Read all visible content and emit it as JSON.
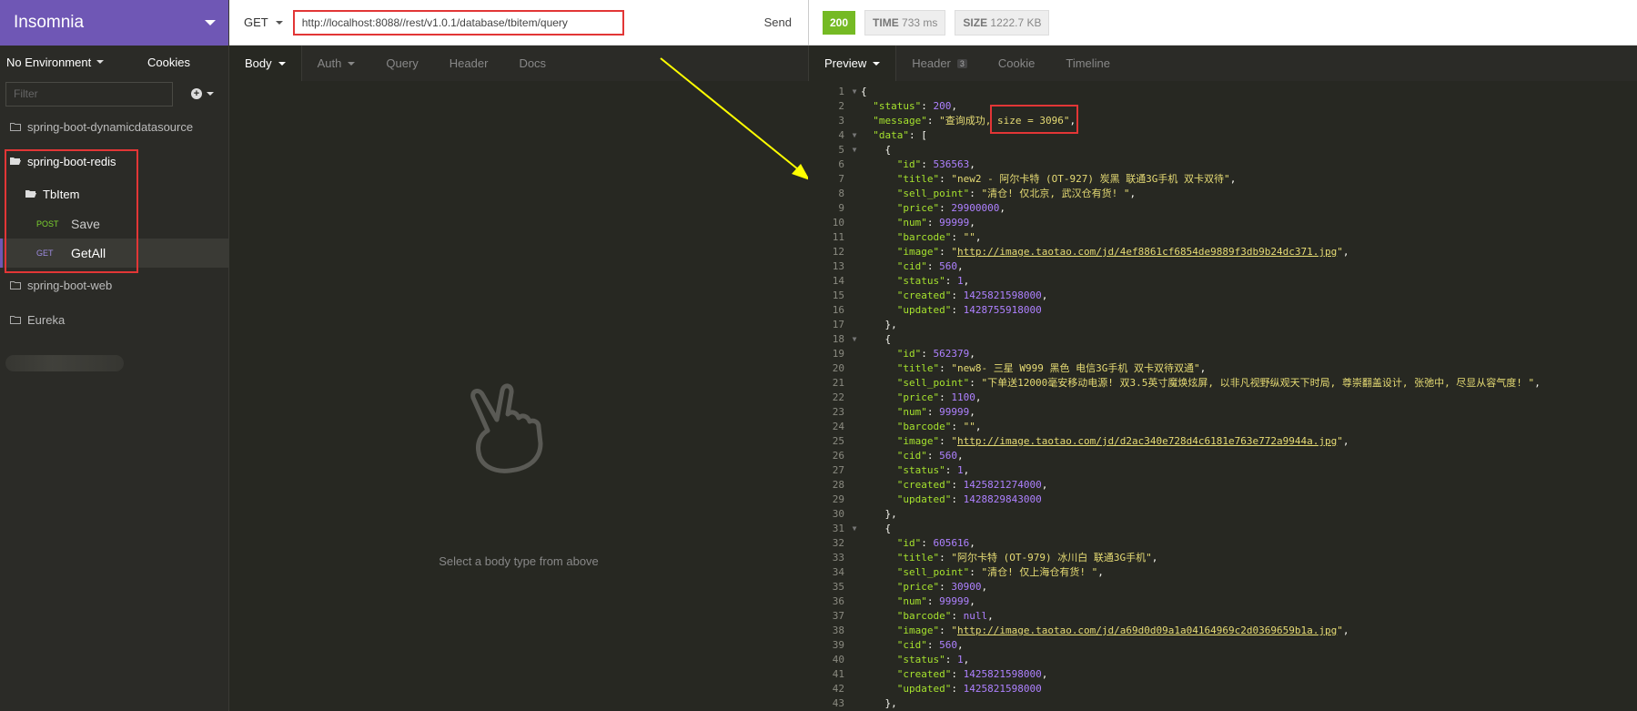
{
  "app": {
    "name": "Insomnia"
  },
  "sidebar": {
    "environment": "No Environment",
    "cookies": "Cookies",
    "filter_placeholder": "Filter",
    "folders": [
      {
        "name": "spring-boot-dynamicdatasource"
      },
      {
        "name": "spring-boot-redis"
      },
      {
        "name": "spring-boot-web"
      },
      {
        "name": "Eureka"
      }
    ],
    "subfolder": "TbItem",
    "requests": [
      {
        "method": "POST",
        "name": "Save"
      },
      {
        "method": "GET",
        "name": "GetAll"
      }
    ]
  },
  "request": {
    "method": "GET",
    "url": "http://localhost:8088//rest/v1.0.1/database/tbitem/query",
    "send": "Send",
    "tabs": [
      "Body",
      "Auth",
      "Query",
      "Header",
      "Docs"
    ],
    "empty_text": "Select a body type from above"
  },
  "response": {
    "status": "200",
    "time_label": "TIME",
    "time_value": "733 ms",
    "size_label": "SIZE",
    "size_value": "1222.7 KB",
    "tabs": [
      "Preview",
      "Header",
      "Cookie",
      "Timeline"
    ],
    "header_count": "3"
  },
  "code_lines": [
    [
      {
        "t": "p",
        "v": "{"
      }
    ],
    [
      {
        "t": "p",
        "v": "  "
      },
      {
        "t": "k",
        "v": "\"status\""
      },
      {
        "t": "p",
        "v": ": "
      },
      {
        "t": "n",
        "v": "200"
      },
      {
        "t": "p",
        "v": ","
      }
    ],
    [
      {
        "t": "p",
        "v": "  "
      },
      {
        "t": "k",
        "v": "\"message\""
      },
      {
        "t": "p",
        "v": ": "
      },
      {
        "t": "s",
        "v": "\"查询成功, size = 3096\""
      },
      {
        "t": "p",
        "v": ","
      }
    ],
    [
      {
        "t": "p",
        "v": "  "
      },
      {
        "t": "k",
        "v": "\"data\""
      },
      {
        "t": "p",
        "v": ": ["
      }
    ],
    [
      {
        "t": "p",
        "v": "    {"
      }
    ],
    [
      {
        "t": "p",
        "v": "      "
      },
      {
        "t": "k",
        "v": "\"id\""
      },
      {
        "t": "p",
        "v": ": "
      },
      {
        "t": "n",
        "v": "536563"
      },
      {
        "t": "p",
        "v": ","
      }
    ],
    [
      {
        "t": "p",
        "v": "      "
      },
      {
        "t": "k",
        "v": "\"title\""
      },
      {
        "t": "p",
        "v": ": "
      },
      {
        "t": "s",
        "v": "\"new2 - 阿尔卡特 (OT-927) 炭黑 联通3G手机 双卡双待\""
      },
      {
        "t": "p",
        "v": ","
      }
    ],
    [
      {
        "t": "p",
        "v": "      "
      },
      {
        "t": "k",
        "v": "\"sell_point\""
      },
      {
        "t": "p",
        "v": ": "
      },
      {
        "t": "s",
        "v": "\"清仓! 仅北京, 武汉仓有货! \""
      },
      {
        "t": "p",
        "v": ","
      }
    ],
    [
      {
        "t": "p",
        "v": "      "
      },
      {
        "t": "k",
        "v": "\"price\""
      },
      {
        "t": "p",
        "v": ": "
      },
      {
        "t": "n",
        "v": "29900000"
      },
      {
        "t": "p",
        "v": ","
      }
    ],
    [
      {
        "t": "p",
        "v": "      "
      },
      {
        "t": "k",
        "v": "\"num\""
      },
      {
        "t": "p",
        "v": ": "
      },
      {
        "t": "n",
        "v": "99999"
      },
      {
        "t": "p",
        "v": ","
      }
    ],
    [
      {
        "t": "p",
        "v": "      "
      },
      {
        "t": "k",
        "v": "\"barcode\""
      },
      {
        "t": "p",
        "v": ": "
      },
      {
        "t": "s",
        "v": "\"\""
      },
      {
        "t": "p",
        "v": ","
      }
    ],
    [
      {
        "t": "p",
        "v": "      "
      },
      {
        "t": "k",
        "v": "\"image\""
      },
      {
        "t": "p",
        "v": ": "
      },
      {
        "t": "s",
        "v": "\""
      },
      {
        "t": "u",
        "v": "http://image.taotao.com/jd/4ef8861cf6854de9889f3db9b24dc371.jpg"
      },
      {
        "t": "s",
        "v": "\""
      },
      {
        "t": "p",
        "v": ","
      }
    ],
    [
      {
        "t": "p",
        "v": "      "
      },
      {
        "t": "k",
        "v": "\"cid\""
      },
      {
        "t": "p",
        "v": ": "
      },
      {
        "t": "n",
        "v": "560"
      },
      {
        "t": "p",
        "v": ","
      }
    ],
    [
      {
        "t": "p",
        "v": "      "
      },
      {
        "t": "k",
        "v": "\"status\""
      },
      {
        "t": "p",
        "v": ": "
      },
      {
        "t": "n",
        "v": "1"
      },
      {
        "t": "p",
        "v": ","
      }
    ],
    [
      {
        "t": "p",
        "v": "      "
      },
      {
        "t": "k",
        "v": "\"created\""
      },
      {
        "t": "p",
        "v": ": "
      },
      {
        "t": "n",
        "v": "1425821598000"
      },
      {
        "t": "p",
        "v": ","
      }
    ],
    [
      {
        "t": "p",
        "v": "      "
      },
      {
        "t": "k",
        "v": "\"updated\""
      },
      {
        "t": "p",
        "v": ": "
      },
      {
        "t": "n",
        "v": "1428755918000"
      }
    ],
    [
      {
        "t": "p",
        "v": "    },"
      }
    ],
    [
      {
        "t": "p",
        "v": "    {"
      }
    ],
    [
      {
        "t": "p",
        "v": "      "
      },
      {
        "t": "k",
        "v": "\"id\""
      },
      {
        "t": "p",
        "v": ": "
      },
      {
        "t": "n",
        "v": "562379"
      },
      {
        "t": "p",
        "v": ","
      }
    ],
    [
      {
        "t": "p",
        "v": "      "
      },
      {
        "t": "k",
        "v": "\"title\""
      },
      {
        "t": "p",
        "v": ": "
      },
      {
        "t": "s",
        "v": "\"new8- 三星 W999 黑色 电信3G手机 双卡双待双通\""
      },
      {
        "t": "p",
        "v": ","
      }
    ],
    [
      {
        "t": "p",
        "v": "      "
      },
      {
        "t": "k",
        "v": "\"sell_point\""
      },
      {
        "t": "p",
        "v": ": "
      },
      {
        "t": "s",
        "v": "\"下单送12000毫安移动电源! 双3.5英寸魔焕炫屏, 以非凡视野纵观天下时局, 尊崇翻盖设计, 张弛中, 尽显从容气度! \""
      },
      {
        "t": "p",
        "v": ","
      }
    ],
    [
      {
        "t": "p",
        "v": "      "
      },
      {
        "t": "k",
        "v": "\"price\""
      },
      {
        "t": "p",
        "v": ": "
      },
      {
        "t": "n",
        "v": "1100"
      },
      {
        "t": "p",
        "v": ","
      }
    ],
    [
      {
        "t": "p",
        "v": "      "
      },
      {
        "t": "k",
        "v": "\"num\""
      },
      {
        "t": "p",
        "v": ": "
      },
      {
        "t": "n",
        "v": "99999"
      },
      {
        "t": "p",
        "v": ","
      }
    ],
    [
      {
        "t": "p",
        "v": "      "
      },
      {
        "t": "k",
        "v": "\"barcode\""
      },
      {
        "t": "p",
        "v": ": "
      },
      {
        "t": "s",
        "v": "\"\""
      },
      {
        "t": "p",
        "v": ","
      }
    ],
    [
      {
        "t": "p",
        "v": "      "
      },
      {
        "t": "k",
        "v": "\"image\""
      },
      {
        "t": "p",
        "v": ": "
      },
      {
        "t": "s",
        "v": "\""
      },
      {
        "t": "u",
        "v": "http://image.taotao.com/jd/d2ac340e728d4c6181e763e772a9944a.jpg"
      },
      {
        "t": "s",
        "v": "\""
      },
      {
        "t": "p",
        "v": ","
      }
    ],
    [
      {
        "t": "p",
        "v": "      "
      },
      {
        "t": "k",
        "v": "\"cid\""
      },
      {
        "t": "p",
        "v": ": "
      },
      {
        "t": "n",
        "v": "560"
      },
      {
        "t": "p",
        "v": ","
      }
    ],
    [
      {
        "t": "p",
        "v": "      "
      },
      {
        "t": "k",
        "v": "\"status\""
      },
      {
        "t": "p",
        "v": ": "
      },
      {
        "t": "n",
        "v": "1"
      },
      {
        "t": "p",
        "v": ","
      }
    ],
    [
      {
        "t": "p",
        "v": "      "
      },
      {
        "t": "k",
        "v": "\"created\""
      },
      {
        "t": "p",
        "v": ": "
      },
      {
        "t": "n",
        "v": "1425821274000"
      },
      {
        "t": "p",
        "v": ","
      }
    ],
    [
      {
        "t": "p",
        "v": "      "
      },
      {
        "t": "k",
        "v": "\"updated\""
      },
      {
        "t": "p",
        "v": ": "
      },
      {
        "t": "n",
        "v": "1428829843000"
      }
    ],
    [
      {
        "t": "p",
        "v": "    },"
      }
    ],
    [
      {
        "t": "p",
        "v": "    {"
      }
    ],
    [
      {
        "t": "p",
        "v": "      "
      },
      {
        "t": "k",
        "v": "\"id\""
      },
      {
        "t": "p",
        "v": ": "
      },
      {
        "t": "n",
        "v": "605616"
      },
      {
        "t": "p",
        "v": ","
      }
    ],
    [
      {
        "t": "p",
        "v": "      "
      },
      {
        "t": "k",
        "v": "\"title\""
      },
      {
        "t": "p",
        "v": ": "
      },
      {
        "t": "s",
        "v": "\"阿尔卡特 (OT-979) 冰川白 联通3G手机\""
      },
      {
        "t": "p",
        "v": ","
      }
    ],
    [
      {
        "t": "p",
        "v": "      "
      },
      {
        "t": "k",
        "v": "\"sell_point\""
      },
      {
        "t": "p",
        "v": ": "
      },
      {
        "t": "s",
        "v": "\"清仓! 仅上海仓有货! \""
      },
      {
        "t": "p",
        "v": ","
      }
    ],
    [
      {
        "t": "p",
        "v": "      "
      },
      {
        "t": "k",
        "v": "\"price\""
      },
      {
        "t": "p",
        "v": ": "
      },
      {
        "t": "n",
        "v": "30900"
      },
      {
        "t": "p",
        "v": ","
      }
    ],
    [
      {
        "t": "p",
        "v": "      "
      },
      {
        "t": "k",
        "v": "\"num\""
      },
      {
        "t": "p",
        "v": ": "
      },
      {
        "t": "n",
        "v": "99999"
      },
      {
        "t": "p",
        "v": ","
      }
    ],
    [
      {
        "t": "p",
        "v": "      "
      },
      {
        "t": "k",
        "v": "\"barcode\""
      },
      {
        "t": "p",
        "v": ": "
      },
      {
        "t": "n",
        "v": "null"
      },
      {
        "t": "p",
        "v": ","
      }
    ],
    [
      {
        "t": "p",
        "v": "      "
      },
      {
        "t": "k",
        "v": "\"image\""
      },
      {
        "t": "p",
        "v": ": "
      },
      {
        "t": "s",
        "v": "\""
      },
      {
        "t": "u",
        "v": "http://image.taotao.com/jd/a69d0d09a1a04164969c2d0369659b1a.jpg"
      },
      {
        "t": "s",
        "v": "\""
      },
      {
        "t": "p",
        "v": ","
      }
    ],
    [
      {
        "t": "p",
        "v": "      "
      },
      {
        "t": "k",
        "v": "\"cid\""
      },
      {
        "t": "p",
        "v": ": "
      },
      {
        "t": "n",
        "v": "560"
      },
      {
        "t": "p",
        "v": ","
      }
    ],
    [
      {
        "t": "p",
        "v": "      "
      },
      {
        "t": "k",
        "v": "\"status\""
      },
      {
        "t": "p",
        "v": ": "
      },
      {
        "t": "n",
        "v": "1"
      },
      {
        "t": "p",
        "v": ","
      }
    ],
    [
      {
        "t": "p",
        "v": "      "
      },
      {
        "t": "k",
        "v": "\"created\""
      },
      {
        "t": "p",
        "v": ": "
      },
      {
        "t": "n",
        "v": "1425821598000"
      },
      {
        "t": "p",
        "v": ","
      }
    ],
    [
      {
        "t": "p",
        "v": "      "
      },
      {
        "t": "k",
        "v": "\"updated\""
      },
      {
        "t": "p",
        "v": ": "
      },
      {
        "t": "n",
        "v": "1425821598000"
      }
    ],
    [
      {
        "t": "p",
        "v": "    },"
      }
    ]
  ],
  "fold_lines": [
    1,
    4,
    5,
    18,
    31
  ],
  "colors": {
    "brand": "#6f57b5",
    "status_ok": "#75ba24",
    "highlight": "#e23636",
    "arrow": "#ffff00"
  }
}
